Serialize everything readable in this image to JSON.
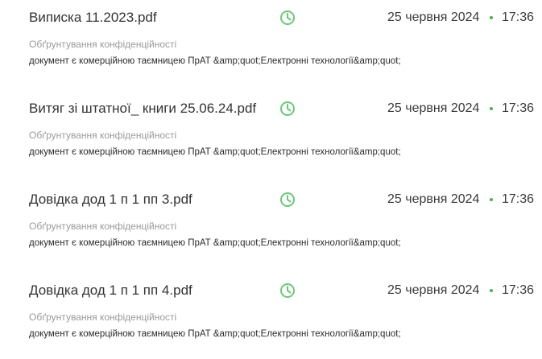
{
  "colors": {
    "accent_green": "#6cc77a",
    "dot_green": "#4caf50"
  },
  "documents": [
    {
      "file_name": "Виписка 11.2023.pdf",
      "status_icon": "clock-icon",
      "date": "25 червня 2024",
      "time": "17:36",
      "justification_label": "Обґрунтування конфіденційності",
      "description": "документ є комерційною таємницею ПрАТ &amp;quot;Електронні технології&amp;quot;"
    },
    {
      "file_name": "Витяг зі штатної_ книги 25.06.24.pdf",
      "status_icon": "clock-icon",
      "date": "25 червня 2024",
      "time": "17:36",
      "justification_label": "Обґрунтування конфіденційності",
      "description": "документ є комерційною таємницею ПрАТ &amp;quot;Електронні технології&amp;quot;"
    },
    {
      "file_name": "Довідка дод 1 п 1 пп 3.pdf",
      "status_icon": "clock-icon",
      "date": "25 червня 2024",
      "time": "17:36",
      "justification_label": "Обґрунтування конфіденційності",
      "description": "документ є комерційною таємницею ПрАТ &amp;quot;Електронні технології&amp;quot;"
    },
    {
      "file_name": "Довідка дод 1 п 1 пп 4.pdf",
      "status_icon": "clock-icon",
      "date": "25 червня 2024",
      "time": "17:36",
      "justification_label": "Обґрунтування конфіденційності",
      "description": "документ є комерційною таємницею ПрАТ &amp;quot;Електронні технології&amp;quot;"
    }
  ]
}
